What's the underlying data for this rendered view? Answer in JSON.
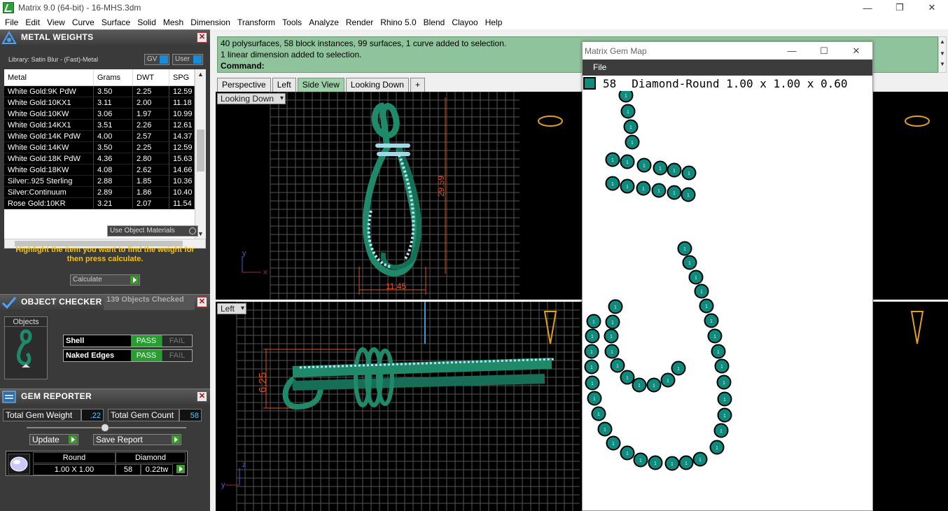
{
  "window": {
    "title": "Matrix 9.0 (64-bit) - 16-MHS.3dm"
  },
  "menu": [
    "File",
    "Edit",
    "View",
    "Curve",
    "Surface",
    "Solid",
    "Mesh",
    "Dimension",
    "Transform",
    "Tools",
    "Analyze",
    "Render",
    "Rhino 5.0",
    "Blend",
    "Clayoo",
    "Help"
  ],
  "metal_weights": {
    "title": "METAL WEIGHTS",
    "library": "Library: Satin Blur - (Fast)-Metal",
    "gv": "GV",
    "user": "User",
    "columns": [
      "Metal",
      "Grams",
      "DWT",
      "SPG"
    ],
    "rows": [
      [
        "White Gold:9K PdW",
        "3.50",
        "2.25",
        "12.59"
      ],
      [
        "White Gold:10KX1",
        "3.11",
        "2.00",
        "11.18"
      ],
      [
        "White Gold:10KW",
        "3.06",
        "1.97",
        "10.99"
      ],
      [
        "White Gold:14KX1",
        "3.51",
        "2.26",
        "12.61"
      ],
      [
        "White Gold:14K PdW",
        "4.00",
        "2.57",
        "14.37"
      ],
      [
        "White Gold:14KW",
        "3.50",
        "2.25",
        "12.59"
      ],
      [
        "White Gold:18K PdW",
        "4.36",
        "2.80",
        "15.63"
      ],
      [
        "White Gold:18KW",
        "4.08",
        "2.62",
        "14.66"
      ],
      [
        "Silver:.925 Sterling",
        "2.88",
        "1.85",
        "10.36"
      ],
      [
        "Silver:Continuum",
        "2.89",
        "1.86",
        "10.40"
      ],
      [
        "Rose Gold:10KR",
        "3.21",
        "2.07",
        "11.54"
      ]
    ],
    "use_object_materials": "Use Object Materials",
    "instruction": "Highlight the item you want to find the weight for then press calculate.",
    "calculate": "Calculate"
  },
  "object_checker": {
    "title": "OBJECT CHECKER",
    "count": "139  Objects Checked",
    "objects_label": "Objects",
    "checks": [
      {
        "label": "Shell",
        "pass": "PASS",
        "fail": "FAIL"
      },
      {
        "label": "Naked Edges",
        "pass": "PASS",
        "fail": "FAIL"
      }
    ]
  },
  "gem_reporter": {
    "title": "GEM REPORTER",
    "total_weight_label": "Total Gem Weight",
    "total_weight": ".22",
    "total_count_label": "Total Gem Count",
    "total_count": "58",
    "update": "Update",
    "save_report": "Save Report",
    "shape": "Round",
    "size": "1.00 X 1.00",
    "type": "Diamond",
    "qty": "58",
    "tw": "0.22tw"
  },
  "command": {
    "line1": "40 polysurfaces, 58 block instances, 99 surfaces, 1 curve added to selection.",
    "line2": "1 linear dimension added to selection.",
    "prompt": "Command:"
  },
  "viewport_tabs": [
    "Perspective",
    "Left",
    "Side View",
    "Looking Down",
    "+"
  ],
  "viewports": {
    "top_left_label": "Looking Down",
    "bottom_left_label": "Left",
    "dim_height": "29.59",
    "dim_width": "11.45",
    "dim_side": "6.25",
    "axis_y": "y",
    "axis_x": "x",
    "axis_z": "z"
  },
  "gem_map": {
    "title": "Matrix Gem Map",
    "menu_file": "File",
    "count": "58",
    "description": "Diamond-Round 1.00 x 1.00 x 0.60",
    "color": "#118a7e",
    "gem_label": "1"
  },
  "colors": {
    "accent_green": "#2a9d32",
    "command_bg": "#8fc39b",
    "model_green": "#1f8a6a",
    "gem_teal": "#118a7e",
    "dim_red": "#e05020"
  }
}
